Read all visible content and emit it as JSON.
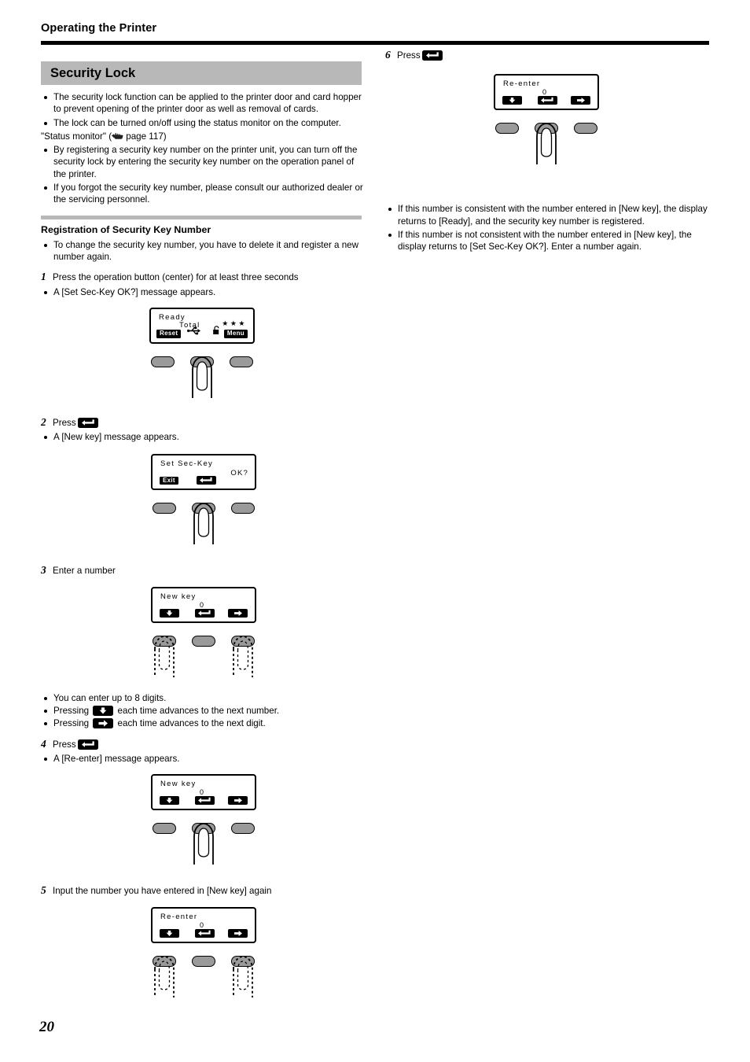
{
  "header": {
    "running_head": "Operating the Printer"
  },
  "section": {
    "title": "Security Lock",
    "bullets": [
      "The security lock function can be applied to the printer door and card hopper to prevent opening of the printer door as well as removal of cards.",
      "The lock can be turned on/off using the status monitor on the computer."
    ],
    "reference_prefix": "\"Status monitor\" (",
    "reference_suffix": " page 117)",
    "bullets2": [
      "By registering a security key number on the printer unit, you can turn off the security lock by entering the security key number on the operation panel of the printer.",
      "If you forgot the security key number, please consult our authorized dealer or the servicing personnel."
    ]
  },
  "subsection": {
    "title": "Registration of Security Key Number",
    "note": "To change the security key number, you have to delete it and register a new number again."
  },
  "steps": {
    "s1": {
      "num": "1",
      "text": "Press the operation button (center) for at least three seconds",
      "note": "A [Set Sec-Key OK?] message appears."
    },
    "s2": {
      "num": "2",
      "text_before": "Press",
      "text_after": "",
      "note": "A [New key] message appears."
    },
    "s3": {
      "num": "3",
      "text": "Enter a number"
    },
    "s4": {
      "num": "4",
      "text_before": "Press",
      "note": "A [Re-enter] message appears."
    },
    "s5": {
      "num": "5",
      "text": "Input the number you have entered in [New key] again"
    },
    "s6": {
      "num": "6",
      "text_before": "Press"
    }
  },
  "step3_notes": [
    "You can enter up to 8 digits.",
    "Pressing ",
    " each time advances to the next number.",
    "Pressing ",
    " each time advances to the next digit."
  ],
  "step6_notes": [
    "If this number is consistent with the number entered in [New key], the display returns to [Ready], and the security key number is registered.",
    "If this number is not consistent with the number entered in [New key], the display returns to [Set Sec-Key OK?]. Enter a number again."
  ],
  "lcd": {
    "ready": {
      "line1": "Ready",
      "line2": "Total",
      "stars": "★★★",
      "softkey_left": "Reset",
      "softkey_right": "Menu"
    },
    "setseckey": {
      "line1": "Set Sec-Key",
      "ok": "OK?",
      "softkey_left": "Exit"
    },
    "newkey": {
      "line1": "New key",
      "value": "0"
    },
    "reenter": {
      "line1": "Re-enter",
      "value": "0"
    }
  },
  "icons": {
    "enter_key": "enter-key-icon",
    "down_key": "down-arrow-key-icon",
    "right_key": "right-arrow-key-icon",
    "usb": "usb-icon",
    "lock": "padlock-icon",
    "hand": "pointing-hand-icon"
  },
  "colors": {
    "section_bar": "#b8b8b8",
    "button_fill": "#9a9a9a",
    "rule": "#000000"
  },
  "footer": {
    "page_number": "20"
  }
}
